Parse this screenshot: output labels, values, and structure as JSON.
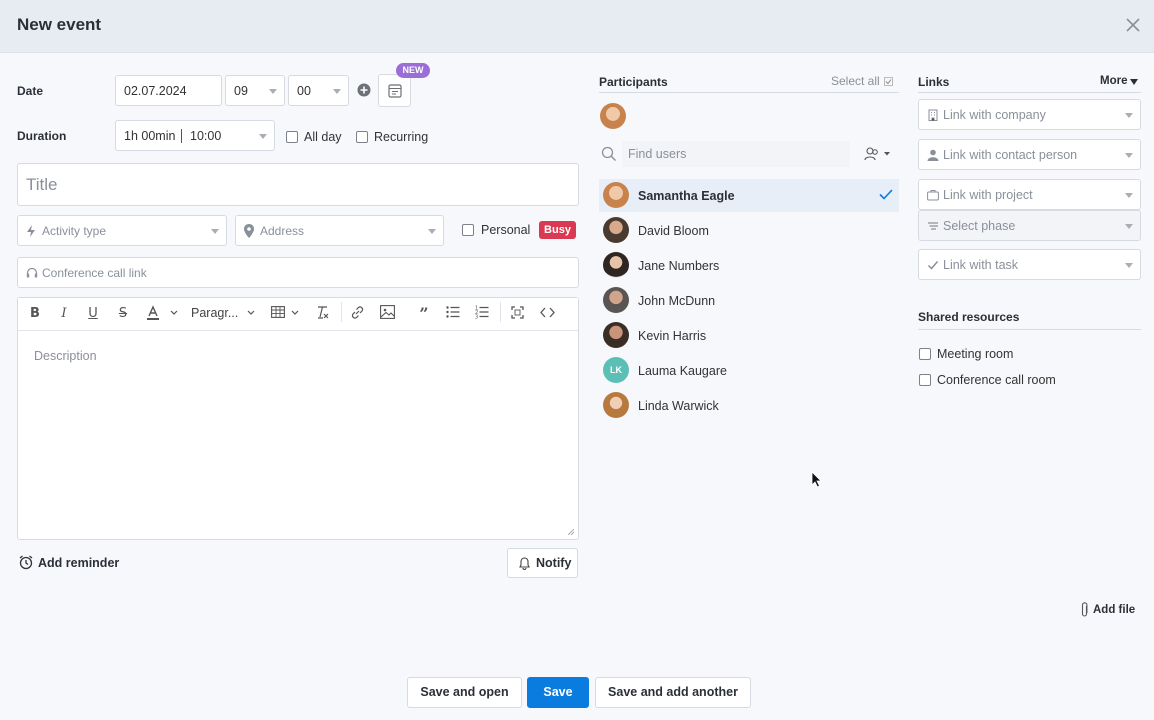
{
  "dialog": {
    "title": "New event"
  },
  "form": {
    "date_label": "Date",
    "date_value": "02.07.2024",
    "hour_value": "09",
    "minute_value": "00",
    "new_badge": "NEW",
    "duration_label": "Duration",
    "duration_value": "1h 00min",
    "end_time_value": "10:00",
    "all_day_label": "All day",
    "recurring_label": "Recurring",
    "title_placeholder": "Title",
    "activity_type_placeholder": "Activity type",
    "address_placeholder": "Address",
    "personal_label": "Personal",
    "busy_badge": "Busy",
    "conference_placeholder": "Conference call link",
    "paragraph_style": "Paragr...",
    "description_placeholder": "Description",
    "add_reminder_label": "Add reminder",
    "notify_label": "Notify"
  },
  "participants": {
    "heading": "Participants",
    "select_all_label": "Select all",
    "find_placeholder": "Find users",
    "users": [
      {
        "name": "Samantha Eagle",
        "selected": true,
        "initials": ""
      },
      {
        "name": "David Bloom",
        "selected": false,
        "initials": ""
      },
      {
        "name": "Jane Numbers",
        "selected": false,
        "initials": ""
      },
      {
        "name": "John McDunn",
        "selected": false,
        "initials": ""
      },
      {
        "name": "Kevin Harris",
        "selected": false,
        "initials": ""
      },
      {
        "name": "Lauma Kaugare",
        "selected": false,
        "initials": "LK"
      },
      {
        "name": "Linda Warwick",
        "selected": false,
        "initials": ""
      }
    ]
  },
  "links": {
    "heading": "Links",
    "more_label": "More",
    "company_placeholder": "Link with company",
    "contact_placeholder": "Link with contact person",
    "project_placeholder": "Link with project",
    "phase_placeholder": "Select phase",
    "task_placeholder": "Link with task"
  },
  "shared_resources": {
    "heading": "Shared resources",
    "items": [
      "Meeting room",
      "Conference call room"
    ]
  },
  "add_file_label": "Add file",
  "footer": {
    "save_and_open": "Save and open",
    "save": "Save",
    "save_and_add_another": "Save and add another"
  },
  "colors": {
    "primary": "#0a7ce0",
    "busy": "#d93952",
    "new_badge": "#9b6dd6",
    "selected_row": "#e8eef8",
    "lk_avatar": "#5bbfb6"
  }
}
